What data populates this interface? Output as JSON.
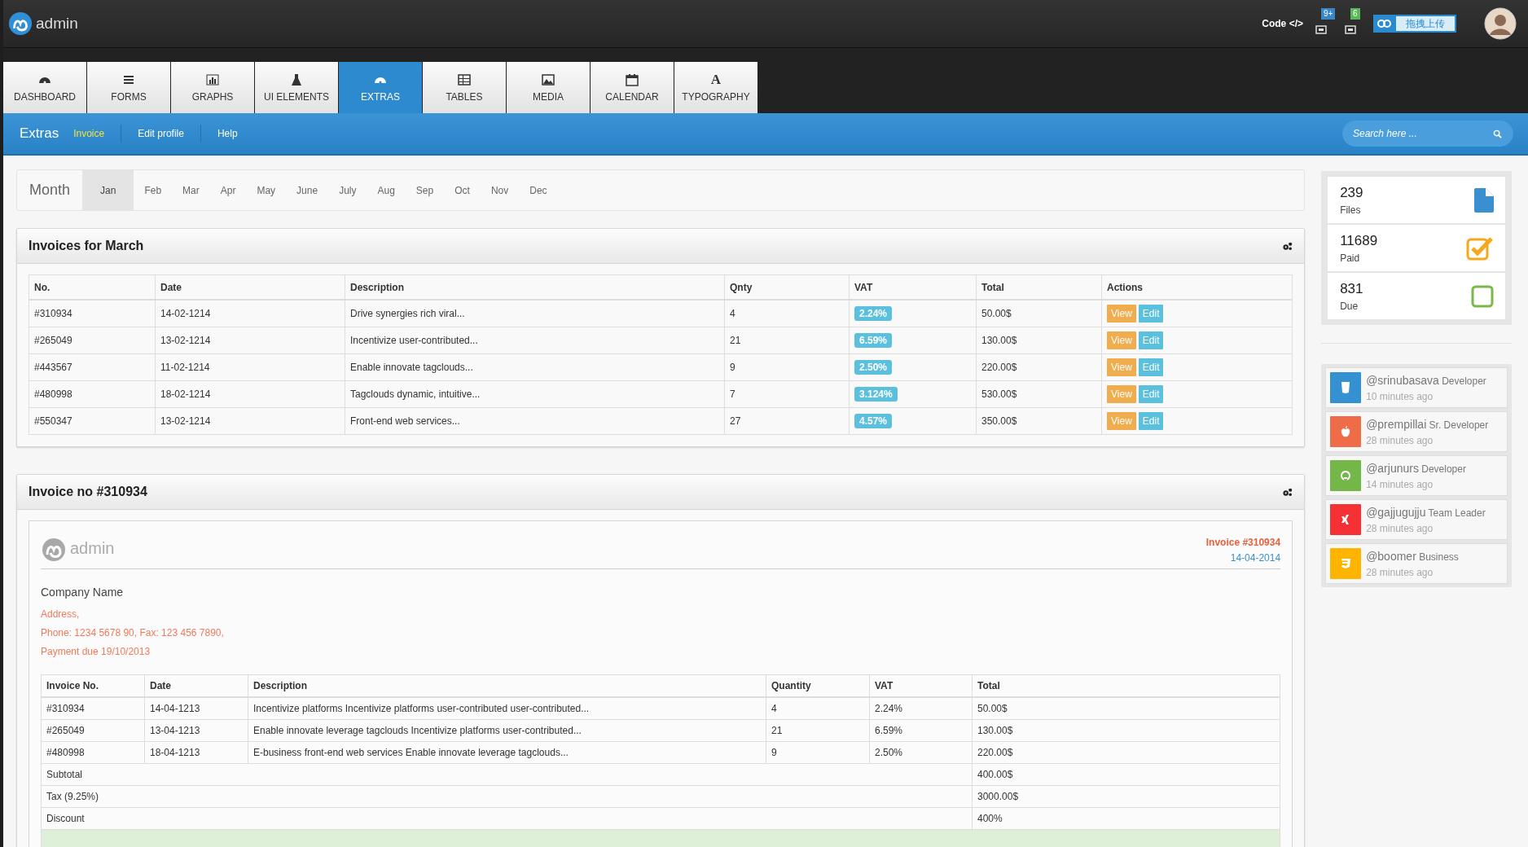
{
  "topbar": {
    "brand": "admin",
    "code_link": "Code",
    "code_glyph": "</>",
    "notifications": [
      {
        "badge": "9+",
        "color": "#3a87c8"
      },
      {
        "badge": "6",
        "color": "#5cb85c"
      }
    ],
    "upload_button": "拖拽上传"
  },
  "tabs": [
    {
      "label": "DASHBOARD",
      "selected": false
    },
    {
      "label": "FORMS",
      "selected": false
    },
    {
      "label": "GRAPHS",
      "selected": false
    },
    {
      "label": "UI ELEMENTS",
      "selected": false
    },
    {
      "label": "EXTRAS",
      "selected": true
    },
    {
      "label": "TABLES",
      "selected": false
    },
    {
      "label": "MEDIA",
      "selected": false
    },
    {
      "label": "CALENDAR",
      "selected": false
    },
    {
      "label": "TYPOGRAPHY",
      "selected": false,
      "glyph": "A"
    }
  ],
  "subnav": {
    "title": "Extras",
    "links": [
      {
        "label": "Invoice",
        "selected": true
      },
      {
        "label": "Edit profile",
        "selected": false
      },
      {
        "label": "Help",
        "selected": false
      }
    ],
    "search": {
      "placeholder": "Search here ..."
    }
  },
  "months": {
    "label": "Month",
    "items": [
      {
        "label": "Jan",
        "selected": true
      },
      {
        "label": "Feb",
        "selected": false
      },
      {
        "label": "Mar",
        "selected": false
      },
      {
        "label": "Apr",
        "selected": false
      },
      {
        "label": "May",
        "selected": false
      },
      {
        "label": "June",
        "selected": false
      },
      {
        "label": "July",
        "selected": false
      },
      {
        "label": "Aug",
        "selected": false
      },
      {
        "label": "Sep",
        "selected": false
      },
      {
        "label": "Oct",
        "selected": false
      },
      {
        "label": "Nov",
        "selected": false
      },
      {
        "label": "Dec",
        "selected": false
      }
    ]
  },
  "invoices_panel": {
    "title": "Invoices for March",
    "columns": [
      "No.",
      "Date",
      "Description",
      "Qnty",
      "VAT",
      "Total",
      "Actions"
    ],
    "rows": [
      {
        "no": "#310934",
        "date": "14-02-1214",
        "description": "Drive synergies rich viral...",
        "qnty": "4",
        "vat": "2.24%",
        "total": "50.00$",
        "actions": [
          {
            "label": "View",
            "kind": "view"
          },
          {
            "label": "Edit",
            "kind": "edit"
          }
        ]
      },
      {
        "no": "#265049",
        "date": "13-02-1214",
        "description": "Incentivize user-contributed...",
        "qnty": "21",
        "vat": "6.59%",
        "total": "130.00$",
        "actions": [
          {
            "label": "View",
            "kind": "view"
          },
          {
            "label": "Edit",
            "kind": "edit"
          }
        ]
      },
      {
        "no": "#443567",
        "date": "11-02-1214",
        "description": "Enable innovate tagclouds...",
        "qnty": "9",
        "vat": "2.50%",
        "total": "220.00$",
        "actions": [
          {
            "label": "View",
            "kind": "view"
          },
          {
            "label": "Edit",
            "kind": "edit"
          }
        ]
      },
      {
        "no": "#480998",
        "date": "18-02-1214",
        "description": "Tagclouds dynamic, intuitive...",
        "qnty": "7",
        "vat": "3.124%",
        "total": "530.00$",
        "actions": [
          {
            "label": "View",
            "kind": "view"
          },
          {
            "label": "Edit",
            "kind": "edit"
          }
        ]
      },
      {
        "no": "#550347",
        "date": "13-02-1214",
        "description": "Front-end web services...",
        "qnty": "27",
        "vat": "4.57%",
        "total": "350.00$",
        "actions": [
          {
            "label": "View",
            "kind": "view"
          },
          {
            "label": "Edit",
            "kind": "edit"
          }
        ]
      }
    ]
  },
  "invoice_panel": {
    "title": "Invoice no #310934",
    "brand": "admin",
    "invoice_number": "Invoice #310934",
    "invoice_date": "14-04-2014",
    "company": "Company Name",
    "address_lines": [
      "Address,",
      "Phone: 1234 5678 90, Fax: 123 456 7890,",
      "Payment due 19/10/2013"
    ],
    "columns": [
      "Invoice No.",
      "Date",
      "Description",
      "Quantity",
      "VAT",
      "Total"
    ],
    "rows": [
      {
        "no": "#310934",
        "date": "14-04-1213",
        "description": "Incentivize platforms Incentivize platforms user-contributed user-contributed...",
        "quantity": "4",
        "vat": "2.24%",
        "total": "50.00$"
      },
      {
        "no": "#265049",
        "date": "13-04-1213",
        "description": "Enable innovate leverage tagclouds Incentivize platforms user-contributed...",
        "quantity": "21",
        "vat": "6.59%",
        "total": "130.00$"
      },
      {
        "no": "#480998",
        "date": "18-04-1213",
        "description": "E-business front-end web services Enable innovate leverage tagclouds...",
        "quantity": "9",
        "vat": "2.50%",
        "total": "220.00$"
      }
    ],
    "summary": [
      {
        "label": "Subtotal",
        "value": "400.00$"
      },
      {
        "label": "Tax (9.25%)",
        "value": "3000.00$"
      },
      {
        "label": "Discount",
        "value": "400%"
      }
    ]
  },
  "stats": [
    {
      "value": "239",
      "label": "Files",
      "kind": "file",
      "color": "#3a8fd0"
    },
    {
      "value": "11689",
      "label": "Paid",
      "kind": "checked",
      "color": "#f5a81c"
    },
    {
      "value": "831",
      "label": "Due",
      "kind": "unchecked",
      "color": "#7ab648"
    }
  ],
  "activity": [
    {
      "user": "@srinubasava",
      "role": "Developer",
      "time": "10 minutes ago",
      "color": "#3591d1"
    },
    {
      "user": "@prempillai",
      "role": "Sr. Developer",
      "time": "28 minutes ago",
      "color": "#ef6c48"
    },
    {
      "user": "@arjunurs",
      "role": "Developer",
      "time": "14 minutes ago",
      "color": "#74b749"
    },
    {
      "user": "@gajjugujju",
      "role": "Team Leader",
      "time": "28 minutes ago",
      "color": "#f53136"
    },
    {
      "user": "@boomer",
      "role": "Business",
      "time": "28 minutes ago",
      "color": "#ffb400"
    }
  ]
}
